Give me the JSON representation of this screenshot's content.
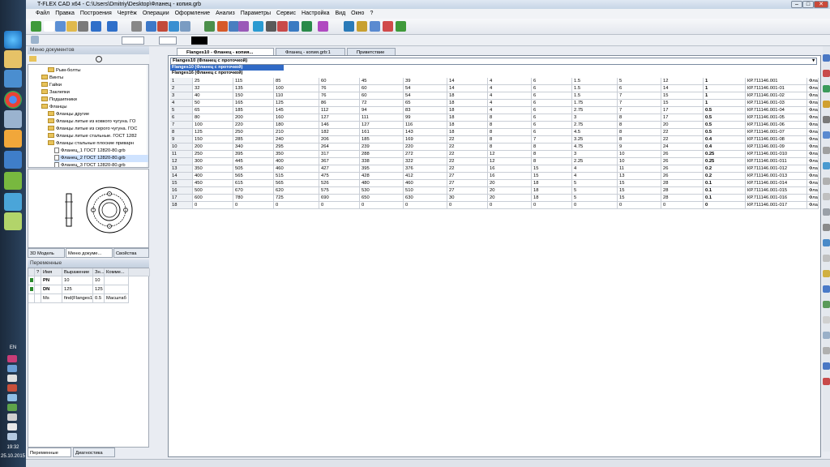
{
  "app": {
    "title": "T-FLEX CAD x64 - C:\\Users\\Dmitriy\\Desktop\\Фланец - копия.grb"
  },
  "menu": [
    "Файл",
    "Правка",
    "Построения",
    "Чертёж",
    "Операции",
    "Оформление",
    "Анализ",
    "Параметры",
    "Сервис",
    "Настройка",
    "Вид",
    "Окно",
    "?"
  ],
  "taskbar": {
    "lang": "EN",
    "time": "19:32",
    "date": "25.10.2015"
  },
  "docmenu": {
    "title": "Меню документов"
  },
  "tree": [
    {
      "label": "Рым-болты",
      "type": "folder",
      "indent": 1
    },
    {
      "label": "Винты",
      "type": "folder",
      "indent": 0
    },
    {
      "label": "Гайки",
      "type": "folder",
      "indent": 0
    },
    {
      "label": "Заклепки",
      "type": "folder",
      "indent": 0
    },
    {
      "label": "Подшипники",
      "type": "folder",
      "indent": 0
    },
    {
      "label": "Фланцы",
      "type": "folder",
      "indent": 0
    },
    {
      "label": "Фланцы другие",
      "type": "folder",
      "indent": 1
    },
    {
      "label": "Фланцы литые из ковкого чугуна. ГО",
      "type": "folder",
      "indent": 1
    },
    {
      "label": "Фланцы литые из серого чугуна. ГОС",
      "type": "folder",
      "indent": 1
    },
    {
      "label": "Фланцы литые стальные. ГОСТ 1282",
      "type": "folder",
      "indent": 1
    },
    {
      "label": "Фланцы стальные плоские приварн",
      "type": "folder",
      "indent": 1
    },
    {
      "label": "Фланец_1 ГОСТ 12820-80.grb",
      "type": "doc",
      "indent": 2
    },
    {
      "label": "Фланец_2 ГОСТ 12820-80.grb",
      "type": "doc",
      "indent": 2,
      "selected": true
    },
    {
      "label": "Фланец_3 ГОСТ 12820-80.grb",
      "type": "doc",
      "indent": 2
    }
  ],
  "panel_tabs": [
    "3D Модель",
    "Меню докуме...",
    "Свойства"
  ],
  "variables": {
    "title": "Переменные",
    "headers": [
      "",
      "?",
      "Имя",
      "Выражение",
      "Зн...",
      "Комме...",
      ""
    ],
    "rows": [
      {
        "name": "PN",
        "expr": "10",
        "val": "10",
        "comment": ""
      },
      {
        "name": "DN",
        "expr": "125",
        "val": "125",
        "comment": ""
      },
      {
        "name": "Ms",
        "expr": "find(Flanges1...",
        "val": "0.5",
        "comment": "Масштаб"
      }
    ]
  },
  "bottom_tabs": [
    "Переменные",
    "Диагностика"
  ],
  "doc_tabs": [
    "Flanges10 - Фланец - копия...",
    "Фланец - копия.grb:1",
    "Приветствие"
  ],
  "combo": {
    "value": "Flanges10 (Фланец с проточкой)",
    "options": [
      "Flanges10 (Фланец с проточкой)",
      "Flanges16 (Фланец с проточкой)"
    ]
  },
  "table": {
    "rows": [
      [
        "1",
        "25",
        "115",
        "85",
        "60",
        "45",
        "39",
        "14",
        "4",
        "6",
        "1.5",
        "5",
        "12",
        "1",
        "КР.711146.001",
        "Фла"
      ],
      [
        "2",
        "32",
        "135",
        "100",
        "76",
        "60",
        "54",
        "14",
        "4",
        "6",
        "1.5",
        "6",
        "14",
        "1",
        "КР.711146.001-01",
        "Фла"
      ],
      [
        "3",
        "40",
        "150",
        "110",
        "76",
        "60",
        "54",
        "18",
        "4",
        "6",
        "1.5",
        "7",
        "15",
        "1",
        "КР.711146.001-02",
        "Фла"
      ],
      [
        "4",
        "50",
        "165",
        "125",
        "86",
        "72",
        "65",
        "18",
        "4",
        "6",
        "1.75",
        "7",
        "15",
        "1",
        "КР.711146.001-03",
        "Фла"
      ],
      [
        "5",
        "65",
        "185",
        "145",
        "112",
        "94",
        "83",
        "18",
        "4",
        "6",
        "2.75",
        "7",
        "17",
        "0.5",
        "КР.711146.001-04",
        "Фла"
      ],
      [
        "6",
        "80",
        "200",
        "160",
        "127",
        "111",
        "99",
        "18",
        "8",
        "6",
        "3",
        "8",
        "17",
        "0.5",
        "КР.711146.001-05",
        "Фла"
      ],
      [
        "7",
        "100",
        "220",
        "180",
        "146",
        "127",
        "116",
        "18",
        "8",
        "6",
        "2.75",
        "8",
        "20",
        "0.5",
        "КР.711146.001-06",
        "Фла"
      ],
      [
        "8",
        "125",
        "250",
        "210",
        "182",
        "161",
        "143",
        "18",
        "8",
        "6",
        "4.5",
        "8",
        "22",
        "0.5",
        "КР.711146.001-07",
        "Фла"
      ],
      [
        "9",
        "150",
        "285",
        "240",
        "206",
        "185",
        "169",
        "22",
        "8",
        "7",
        "3.25",
        "8",
        "22",
        "0.4",
        "КР.711146.001-08",
        "Фла"
      ],
      [
        "10",
        "200",
        "340",
        "295",
        "264",
        "239",
        "220",
        "22",
        "8",
        "8",
        "4.75",
        "9",
        "24",
        "0.4",
        "КР.711146.001-09",
        "Фла"
      ],
      [
        "11",
        "250",
        "395",
        "350",
        "317",
        "288",
        "272",
        "22",
        "12",
        "8",
        "3",
        "10",
        "26",
        "0.25",
        "КР.711146.001-010",
        "Фла"
      ],
      [
        "12",
        "300",
        "445",
        "400",
        "367",
        "338",
        "322",
        "22",
        "12",
        "8",
        "2.25",
        "10",
        "26",
        "0.25",
        "КР.711146.001-011",
        "Фла"
      ],
      [
        "13",
        "350",
        "505",
        "460",
        "427",
        "395",
        "376",
        "22",
        "16",
        "15",
        "4",
        "11",
        "26",
        "0.2",
        "КР.711146.001-012",
        "Фла"
      ],
      [
        "14",
        "400",
        "565",
        "515",
        "475",
        "428",
        "412",
        "27",
        "16",
        "15",
        "4",
        "13",
        "26",
        "0.2",
        "КР.711146.001-013",
        "Фла"
      ],
      [
        "15",
        "450",
        "615",
        "565",
        "526",
        "480",
        "460",
        "27",
        "20",
        "18",
        "5",
        "15",
        "28",
        "0.1",
        "КР.711146.001-014",
        "Фла"
      ],
      [
        "16",
        "500",
        "670",
        "620",
        "575",
        "530",
        "510",
        "27",
        "20",
        "18",
        "5",
        "15",
        "28",
        "0.1",
        "КР.711146.001-015",
        "Фла"
      ],
      [
        "17",
        "600",
        "780",
        "725",
        "690",
        "650",
        "630",
        "30",
        "20",
        "18",
        "5",
        "15",
        "28",
        "0.1",
        "КР.711146.001-016",
        "Фла"
      ],
      [
        "18",
        "0",
        "0",
        "0",
        "0",
        "0",
        "0",
        "0",
        "0",
        "0",
        "0",
        "0",
        "0",
        "0",
        "КР.711146.001-017",
        "Фла"
      ]
    ]
  },
  "colors": {
    "accent": "#316ac5",
    "selection": "#cfe3ff"
  }
}
